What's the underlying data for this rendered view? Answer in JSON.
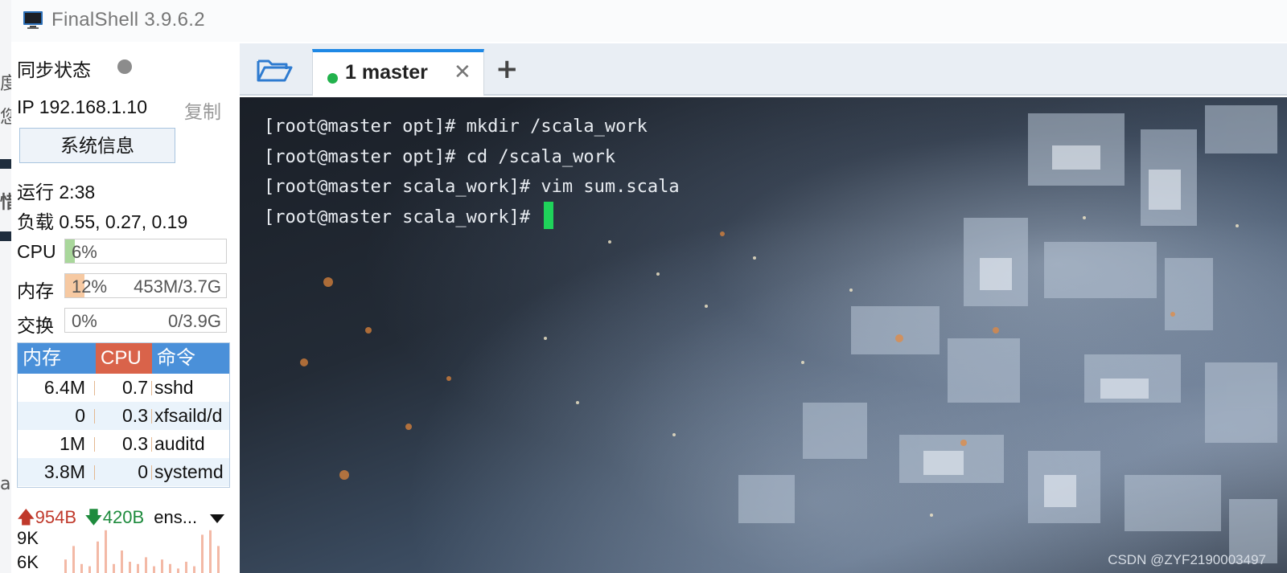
{
  "window": {
    "title": "FinalShell 3.9.6.2"
  },
  "sidebar": {
    "sync_label": "同步状态",
    "ip_text": "IP 192.168.1.10",
    "copy_label": "复制",
    "sysinfo_button": "系统信息",
    "uptime": "运行 2:38",
    "load": "负载 0.55, 0.27, 0.19",
    "cpu": {
      "label": "CPU",
      "value": "6%",
      "fraction": 0.06
    },
    "mem": {
      "label": "内存",
      "value": "12%",
      "detail": "453M/3.7G",
      "fraction": 0.12
    },
    "swap": {
      "label": "交换",
      "value": "0%",
      "detail": "0/3.9G",
      "fraction": 0.0
    },
    "process_table": {
      "headers": [
        "内存",
        "CPU",
        "命令"
      ],
      "rows": [
        {
          "mem": "6.4M",
          "cpu": "0.7",
          "cmd": "sshd"
        },
        {
          "mem": "0",
          "cpu": "0.3",
          "cmd": "xfsaild/d"
        },
        {
          "mem": "1M",
          "cpu": "0.3",
          "cmd": "auditd"
        },
        {
          "mem": "3.8M",
          "cpu": "0",
          "cmd": "systemd"
        }
      ]
    },
    "network": {
      "upload": "954B",
      "download": "420B",
      "interface": "ens...",
      "y_labels": [
        "9K",
        "6K"
      ],
      "bars": [
        0.3,
        0.6,
        0.2,
        0.15,
        0.7,
        0.95,
        0.2,
        0.5,
        0.25,
        0.2,
        0.35,
        0.15,
        0.3,
        0.2,
        0.1,
        0.25,
        0.15,
        0.85,
        0.95,
        0.6
      ]
    },
    "colors": {
      "cpu_fill": "#a9d79b",
      "mem_fill": "#f6c9a2",
      "table_header_blue": "#4a90d9",
      "table_header_red": "#d9634a",
      "row_alt": "#eaf3fb"
    }
  },
  "tabs": {
    "items": [
      {
        "label": "1 master",
        "status_color": "#22b24c",
        "active": true
      }
    ],
    "folder_icon": "folder-open-icon",
    "add_icon": "plus-icon"
  },
  "terminal": {
    "lines": [
      "[root@master opt]# mkdir /scala_work",
      "[root@master opt]# cd /scala_work",
      "[root@master scala_work]# vim sum.scala",
      "[root@master scala_work]# "
    ],
    "watermark": "CSDN @ZYF2190003497"
  }
}
